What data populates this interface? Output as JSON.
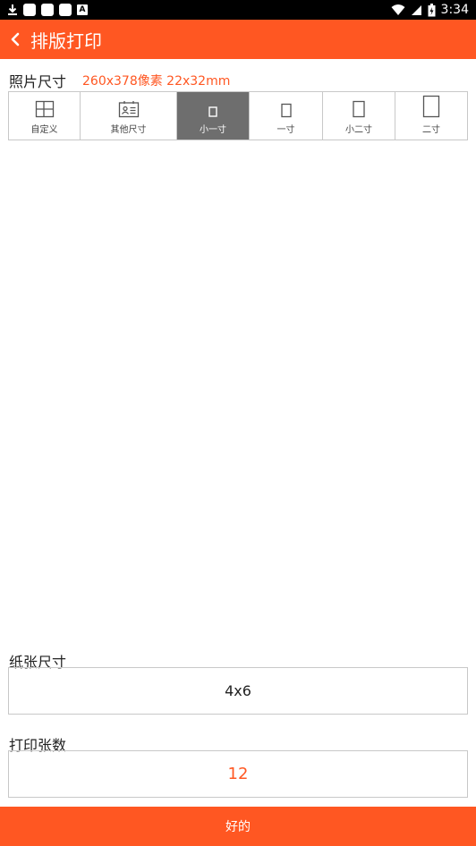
{
  "status_bar": {
    "time": "3:34",
    "notification_letter": "A"
  },
  "header": {
    "title": "排版打印"
  },
  "photo_size": {
    "label": "照片尺寸",
    "info": "260x378像素 22x32mm",
    "tabs": [
      {
        "label": "自定义",
        "icon": "custom-layout-icon",
        "active": false
      },
      {
        "label": "其他尺寸",
        "icon": "id-card-icon",
        "active": false
      },
      {
        "label": "小一寸",
        "icon": "small-rect-icon",
        "active": true
      },
      {
        "label": "一寸",
        "icon": "rect-icon",
        "active": false
      },
      {
        "label": "小二寸",
        "icon": "rect-medium-icon",
        "active": false
      },
      {
        "label": "二寸",
        "icon": "rect-large-icon",
        "active": false
      }
    ]
  },
  "paper_size": {
    "label": "纸张尺寸",
    "value": "4x6"
  },
  "print_count": {
    "label": "打印张数",
    "value": "12"
  },
  "ok_button": {
    "label": "好的"
  },
  "colors": {
    "accent": "#ff5722",
    "active_tab": "#6e6e6e"
  }
}
